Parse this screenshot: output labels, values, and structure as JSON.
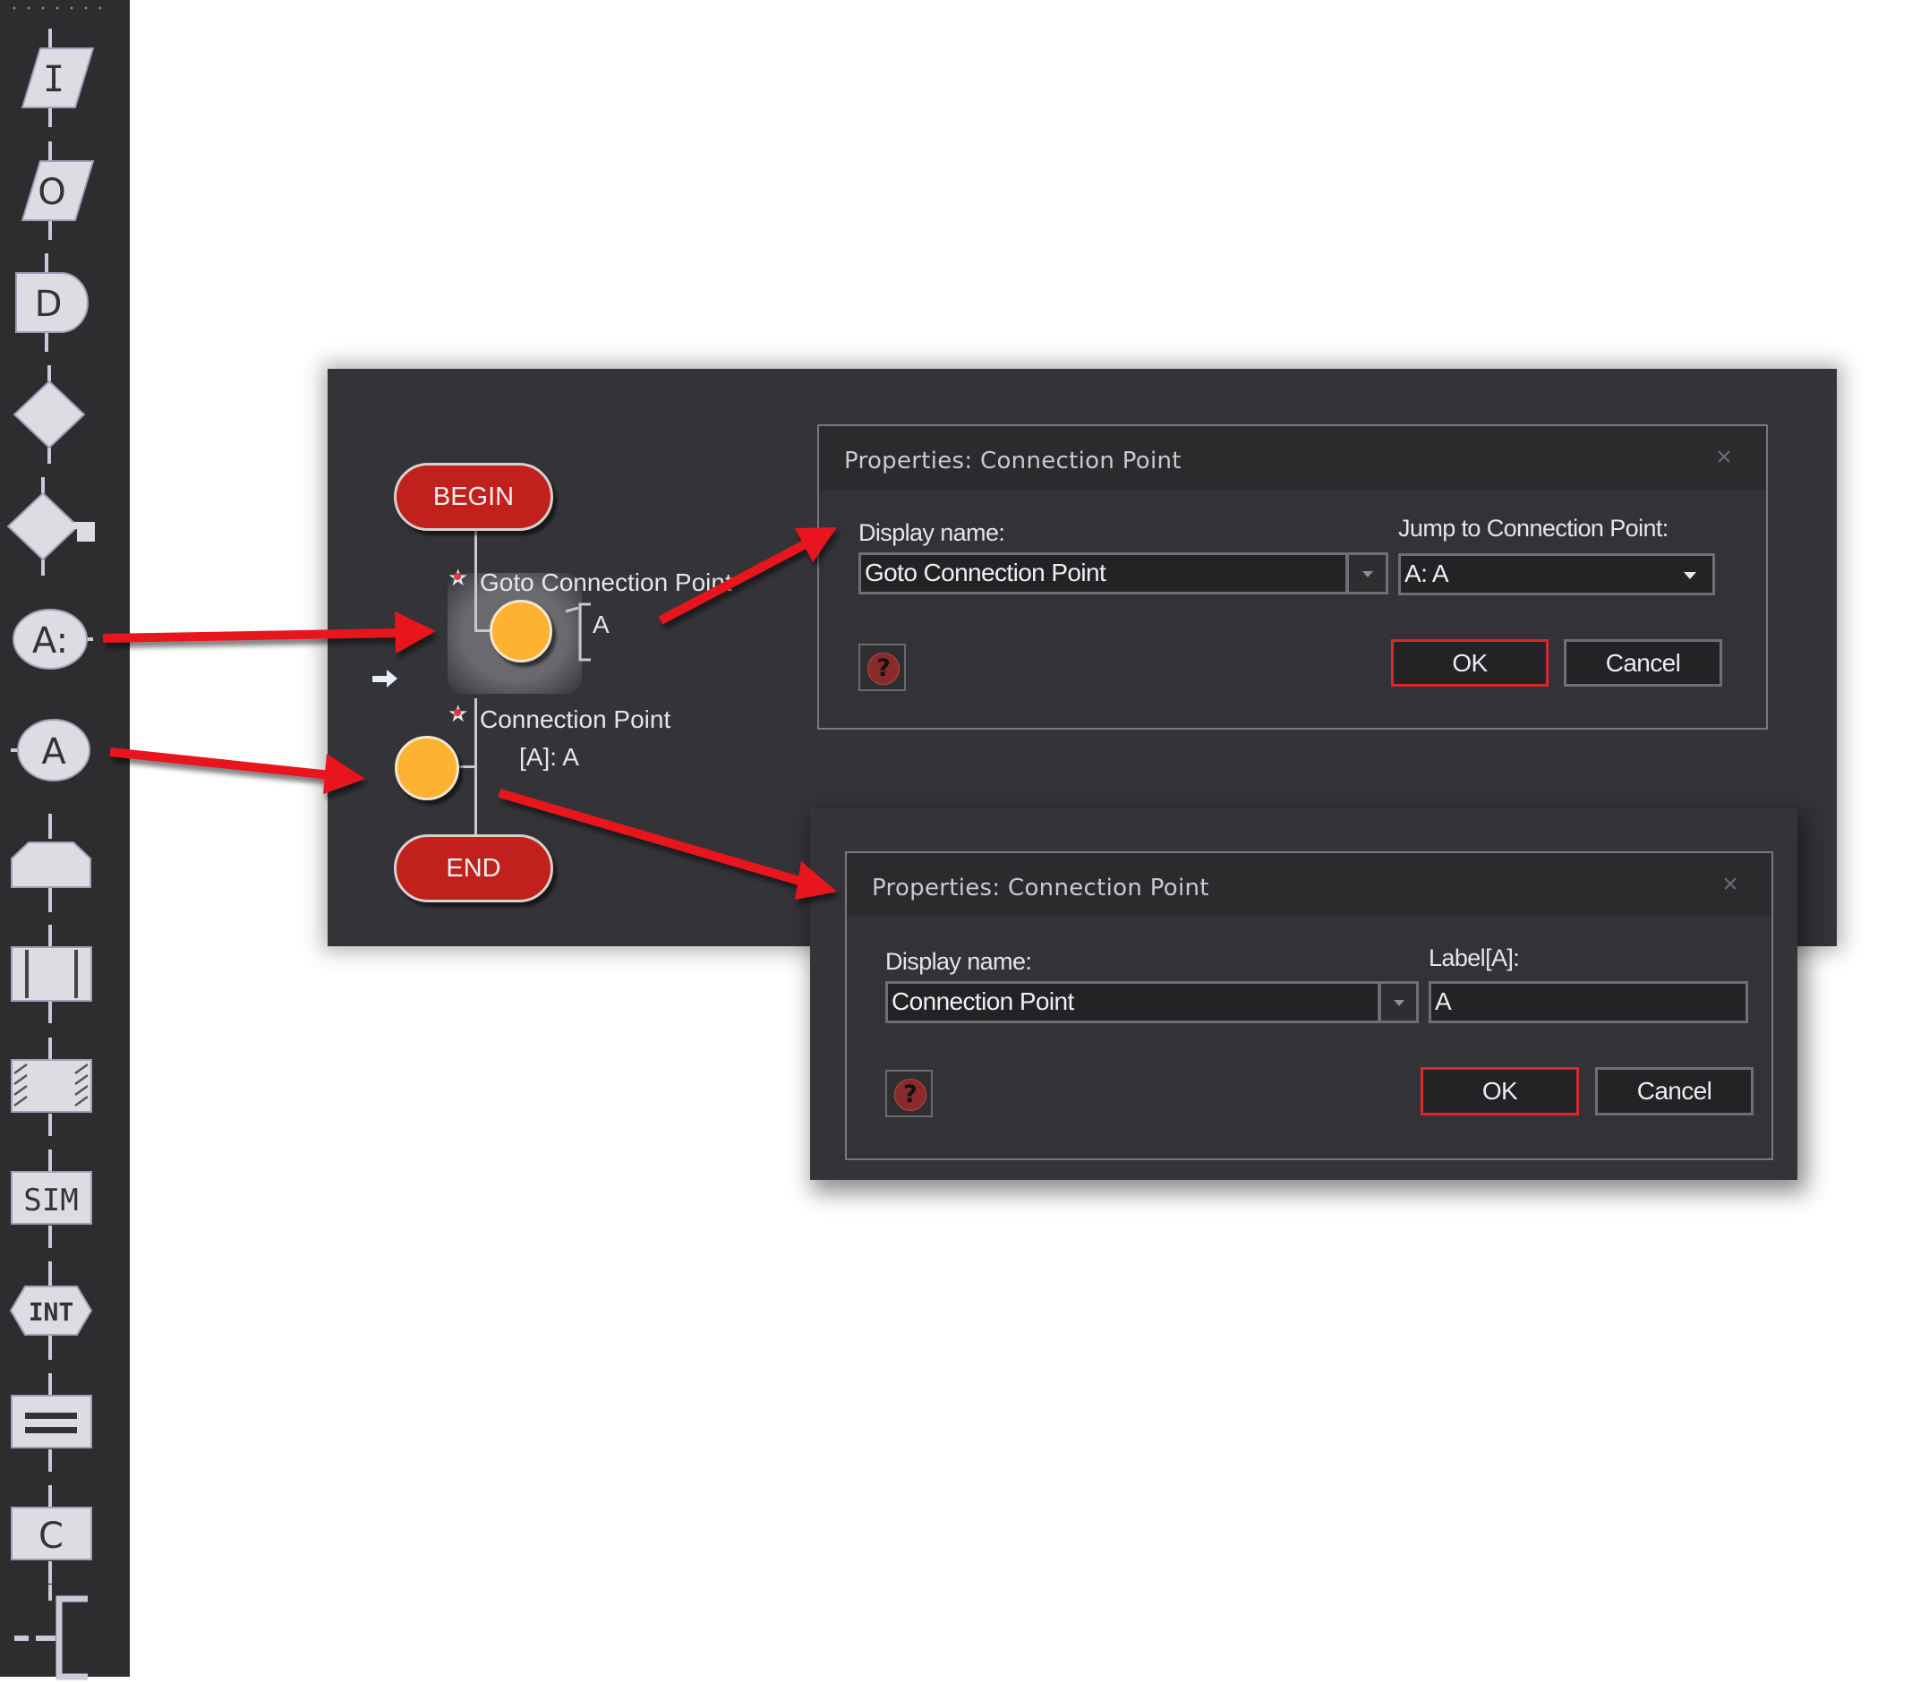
{
  "toolbar": {
    "items": [
      {
        "name": "input",
        "glyph": "I"
      },
      {
        "name": "output",
        "glyph": "O"
      },
      {
        "name": "delay",
        "glyph": "D"
      },
      {
        "name": "decision",
        "glyph": ""
      },
      {
        "name": "decision-key",
        "glyph": ""
      },
      {
        "name": "goto-connection-point",
        "glyph": "A:"
      },
      {
        "name": "connection-point",
        "glyph": "A"
      },
      {
        "name": "loop",
        "glyph": ""
      },
      {
        "name": "predefined-process",
        "glyph": ""
      },
      {
        "name": "hardware-process",
        "glyph": ""
      },
      {
        "name": "simulation",
        "glyph": "SIM"
      },
      {
        "name": "interrupt",
        "glyph": "INT"
      },
      {
        "name": "assignment",
        "glyph": ""
      },
      {
        "name": "c-code",
        "glyph": "C"
      },
      {
        "name": "comment",
        "glyph": ""
      }
    ]
  },
  "flowchart": {
    "begin_label": "BEGIN",
    "end_label": "END",
    "goto_node": {
      "title": "Goto Connection Point",
      "label": "A"
    },
    "connection_node": {
      "title": "Connection Point",
      "label": "[A]: A"
    }
  },
  "dialog_goto": {
    "title": "Properties: Connection Point",
    "display_name_label": "Display name:",
    "display_name_value": "Goto Connection Point",
    "jump_label": "Jump to Connection Point:",
    "jump_value": "A: A",
    "ok_label": "OK",
    "cancel_label": "Cancel",
    "close_glyph": "×",
    "help_glyph": "?"
  },
  "dialog_connection": {
    "title": "Properties: Connection Point",
    "display_name_label": "Display name:",
    "display_name_value": "Connection Point",
    "label_label": "Label[A]:",
    "label_value": "A",
    "ok_label": "OK",
    "cancel_label": "Cancel",
    "close_glyph": "×",
    "help_glyph": "?"
  },
  "colors": {
    "annotation_arrow": "#e8141a",
    "terminal_fill": "#c1201d",
    "node_fill": "#fdb231",
    "primary_button_border": "#d9282b"
  }
}
